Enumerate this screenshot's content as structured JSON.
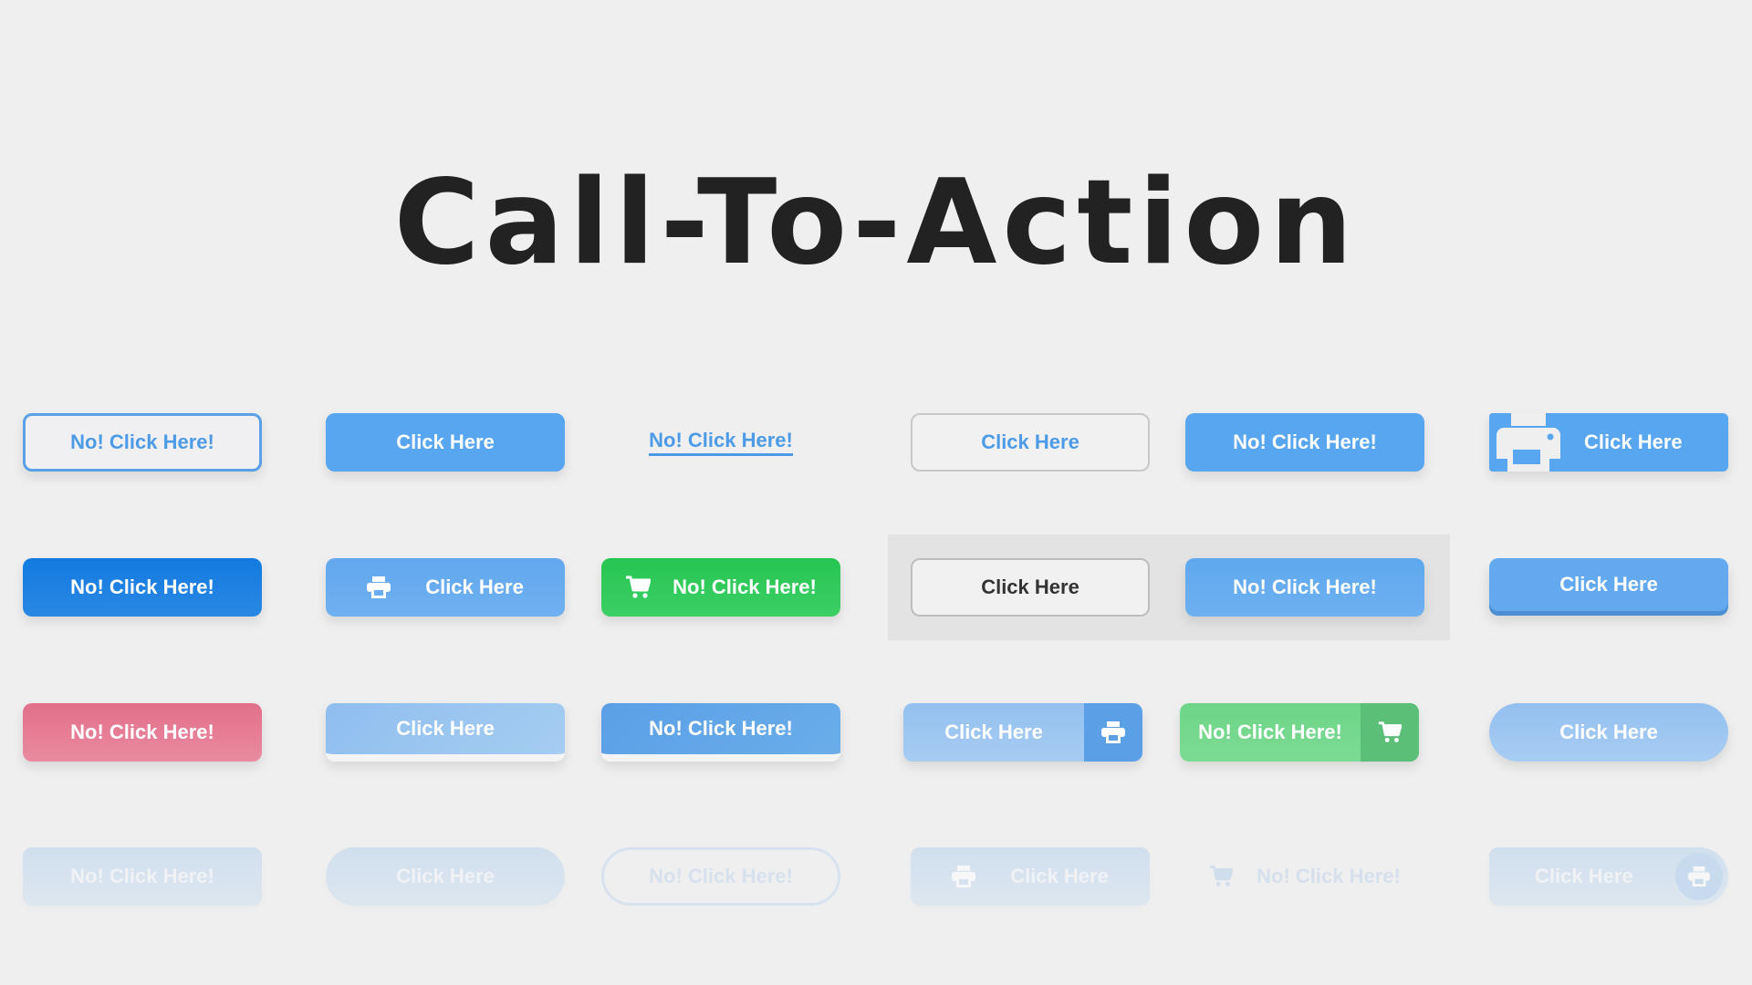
{
  "title": "Call-To-Action",
  "rows": [
    [
      {
        "label": "No! Click Here!",
        "style": "outline-blue"
      },
      {
        "label": "Click Here",
        "style": "solid-blue"
      },
      {
        "label": "No! Click Here!",
        "style": "underlined-link"
      },
      {
        "label": "Click Here",
        "style": "outline-gray"
      },
      {
        "label": "No! Click Here!",
        "style": "solid-blue"
      },
      {
        "label": "Click Here",
        "style": "solid-blue-print-icon",
        "icon": "printer-icon"
      }
    ],
    [
      {
        "label": "No! Click Here!",
        "style": "dark-blue"
      },
      {
        "label": "Click Here",
        "style": "light-blue-print-icon",
        "icon": "printer-icon"
      },
      {
        "label": "No! Click Here!",
        "style": "green-cart-icon",
        "icon": "cart-icon"
      },
      {
        "label": "Click Here",
        "style": "outline-dark-on-panel"
      },
      {
        "label": "No! Click Here!",
        "style": "blue-on-panel"
      },
      {
        "label": "Click Here",
        "style": "3d-blue"
      }
    ],
    [
      {
        "label": "No! Click Here!",
        "style": "pink"
      },
      {
        "label": "Click Here",
        "style": "pale-blue-underline"
      },
      {
        "label": "No! Click Here!",
        "style": "blue-underline"
      },
      {
        "label": "Click Here",
        "style": "split-blue-print",
        "icon": "printer-icon"
      },
      {
        "label": "No! Click Here!",
        "style": "split-green-cart",
        "icon": "cart-icon"
      },
      {
        "label": "Click Here",
        "style": "pill-blue"
      }
    ],
    [
      {
        "label": "No! Click Here!",
        "style": "faded-rect"
      },
      {
        "label": "Click Here",
        "style": "faded-pill"
      },
      {
        "label": "No! Click Here!",
        "style": "faded-outline-pill"
      },
      {
        "label": "Click Here",
        "style": "faded-print-icon",
        "icon": "printer-icon"
      },
      {
        "label": "No! Click Here!",
        "style": "faded-text-cart",
        "icon": "cart-icon"
      },
      {
        "label": "Click Here",
        "style": "faded-circle-print",
        "icon": "printer-icon"
      }
    ]
  ],
  "colors": {
    "background": "#efefef",
    "title": "#222222",
    "blue": "#58a6ef",
    "dark_blue": "#137ae0",
    "green": "#27c552",
    "pink": "#e2708a"
  }
}
